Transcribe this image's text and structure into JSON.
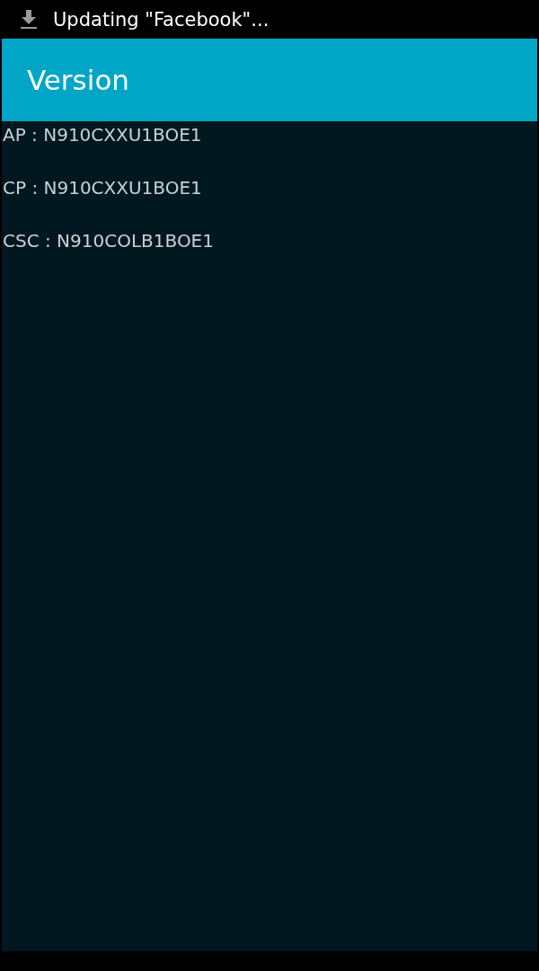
{
  "status_bar": {
    "notification": "Updating \"Facebook\"..."
  },
  "app_bar": {
    "title": "Version"
  },
  "versions": [
    {
      "text": "AP : N910CXXU1BOE1"
    },
    {
      "text": "CP : N910CXXU1BOE1"
    },
    {
      "text": "CSC : N910COLB1BOE1"
    }
  ]
}
